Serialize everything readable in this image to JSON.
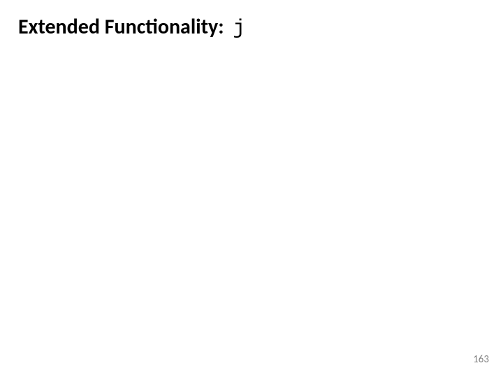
{
  "slide": {
    "title_prefix": "Extended Functionality:",
    "title_code": "j",
    "page_number": "163"
  }
}
